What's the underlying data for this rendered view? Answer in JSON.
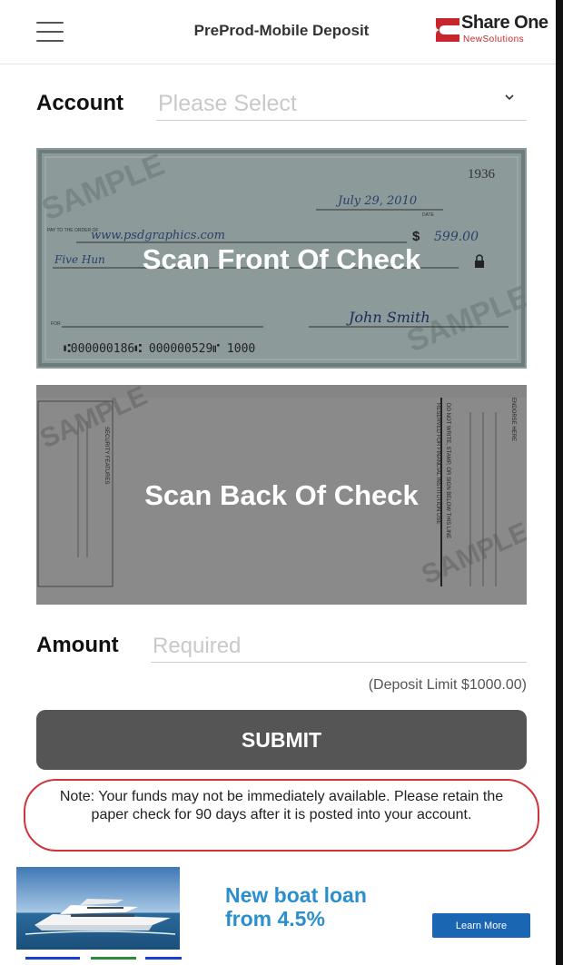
{
  "header": {
    "title": "PreProd-Mobile Deposit",
    "logo_main": "Share One",
    "logo_sub": "NewSolutions"
  },
  "account": {
    "label": "Account",
    "placeholder": "Please Select"
  },
  "check_front": {
    "label": "Scan Front Of Check",
    "watermark": "SAMPLE",
    "number": "1936",
    "date": "July 29, 2010",
    "date_label": "DATE",
    "payee_label": "PAY TO THE ORDER OF",
    "payee": "www.psdgraphics.com",
    "amount": "599.00",
    "dollar_sign": "$",
    "written_amount": "Five Hun",
    "signature": "John Smith",
    "for_label": "FOR",
    "micr": "⑆000000186⑆   000000529⑈   1000"
  },
  "check_back": {
    "label": "Scan Back Of Check",
    "watermark": "SAMPLE",
    "endorse": "ENDORSE HERE",
    "do_not_write": "DO NOT WRITE, STAMP, OR SIGN BELOW THIS LINE",
    "reserved": "RESERVED FOR FINANCIAL INSTITUTION USE",
    "security": "SECURITY FEATURES"
  },
  "amount": {
    "label": "Amount",
    "placeholder": "Required",
    "deposit_limit": "(Deposit Limit $1000.00)"
  },
  "submit": {
    "label": "SUBMIT"
  },
  "note": {
    "text": "Note: Your funds may not be immediately available. Please retain the paper check for 90 days after it is posted into your account."
  },
  "ad": {
    "headline_line1": "New boat loan",
    "headline_line2": "from 4.5%",
    "button": "Learn More"
  },
  "icons": {
    "menu": "hamburger-menu-icon",
    "chevron": "chevron-down-icon",
    "logo": "share-one-logo",
    "lock": "lock-icon"
  },
  "colors": {
    "accent_red": "#d0343b",
    "submit_bg": "#555555",
    "ad_text": "#2c8fcd",
    "ad_button": "#1a66b3"
  }
}
